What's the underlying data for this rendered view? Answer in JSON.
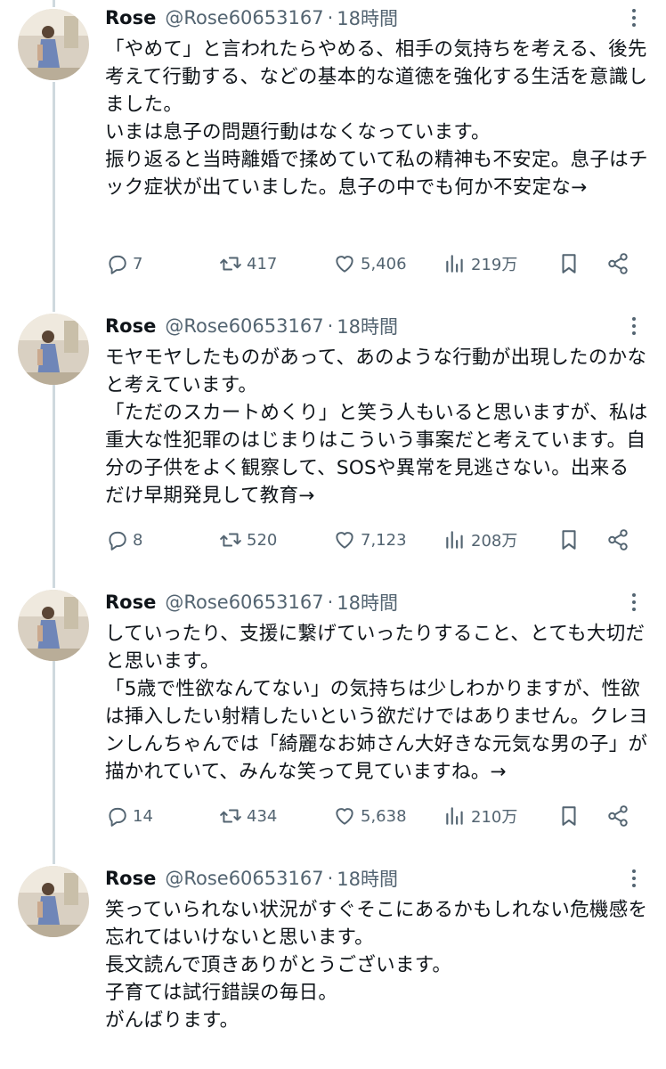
{
  "tweets": [
    {
      "name": "Rose",
      "handle": "@Rose60653167",
      "sep": "·",
      "time": "18時間",
      "lines": [
        "「やめて」と言われたらやめる、相手の気持ちを考える、後先",
        "考えて行動する、などの基本的な道徳を強化する生活を意識し",
        "ました。",
        "",
        "いまは息子の問題行動はなくなっています。",
        "振り返ると当時離婚で揉めていて私の精神も不安定。息子はチ",
        "ック症状が出ていました。息子の中でも何か不安定な→"
      ],
      "replies": "7",
      "retweets": "417",
      "likes": "5,406",
      "views": "219万"
    },
    {
      "name": "Rose",
      "handle": "@Rose60653167",
      "sep": "·",
      "time": "18時間",
      "lines": [
        "モヤモヤしたものがあって、あのような行動が出現したのかな",
        "と考えています。",
        "「ただのスカートめくり」と笑う人もいると思いますが、私は",
        "重大な性犯罪のはじまりはこういう事案だと考えています。自",
        "分の子供をよく観察して、SOSや異常を見逃さない。出来る",
        "だけ早期発見して教育→"
      ],
      "replies": "8",
      "retweets": "520",
      "likes": "7,123",
      "views": "208万"
    },
    {
      "name": "Rose",
      "handle": "@Rose60653167",
      "sep": "·",
      "time": "18時間",
      "lines": [
        "していったり、支援に繋げていったりすること、とても大切だ",
        "と思います。",
        "「5歳で性欲なんてない」の気持ちは少しわかりますが、性欲",
        "は挿入したい射精したいという欲だけではありません。クレヨ",
        "ンしんちゃんでは「綺麗なお姉さん大好きな元気な男の子」が",
        "描かれていて、みんな笑って見ていますね。→"
      ],
      "replies": "14",
      "retweets": "434",
      "likes": "5,638",
      "views": "210万"
    },
    {
      "name": "Rose",
      "handle": "@Rose60653167",
      "sep": "·",
      "time": "18時間",
      "lines": [
        "笑っていられない状況がすぐそこにあるかもしれない危機感を",
        "忘れてはいけないと思います。",
        "",
        "長文読んで頂きありがとうございます。",
        "子育ては試行錯誤の毎日。",
        "がんばります。"
      ]
    }
  ],
  "icons": {
    "more": "more-dots-icon",
    "reply": "reply-icon",
    "retweet": "retweet-icon",
    "like": "heart-icon",
    "views": "views-chart-icon",
    "bookmark": "bookmark-icon",
    "share": "share-icon"
  },
  "colors": {
    "text": "#0f1419",
    "secondary": "#536471",
    "rail": "#cfd9de"
  }
}
